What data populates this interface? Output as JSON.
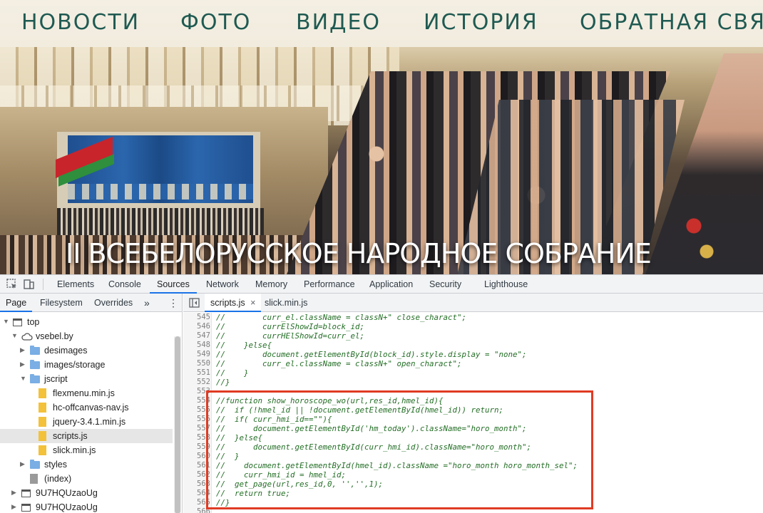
{
  "site": {
    "nav": [
      "НОВОСТИ",
      "ФОТО",
      "ВИДЕО",
      "ИСТОРИЯ",
      "ОБРАТНАЯ СВЯЗЬ"
    ],
    "banner_title": "II ВСЕБЕЛОРУССКОЕ НАРОДНОЕ СОБРАНИЕ"
  },
  "devtools": {
    "tabs": [
      "Elements",
      "Console",
      "Sources",
      "Network",
      "Memory",
      "Performance",
      "Application",
      "Security",
      "Lighthouse"
    ],
    "active_tab": "Sources",
    "navigator_tabs": [
      "Page",
      "Filesystem",
      "Overrides"
    ],
    "more_tabs": "»",
    "menu": "⋮",
    "tree": [
      {
        "label": "top",
        "type": "frame",
        "depth": 0,
        "expanded": true
      },
      {
        "label": "vsebel.by",
        "type": "domain",
        "depth": 1,
        "expanded": true
      },
      {
        "label": "desimages",
        "type": "folder",
        "depth": 2,
        "expanded": false
      },
      {
        "label": "images/storage",
        "type": "folder",
        "depth": 2,
        "expanded": false
      },
      {
        "label": "jscript",
        "type": "folder",
        "depth": 2,
        "expanded": true
      },
      {
        "label": "flexmenu.min.js",
        "type": "js",
        "depth": 3
      },
      {
        "label": "hc-offcanvas-nav.js",
        "type": "js",
        "depth": 3
      },
      {
        "label": "jquery-3.4.1.min.js",
        "type": "js",
        "depth": 3
      },
      {
        "label": "scripts.js",
        "type": "js",
        "depth": 3,
        "selected": true
      },
      {
        "label": "slick.min.js",
        "type": "js",
        "depth": 3
      },
      {
        "label": "styles",
        "type": "folder",
        "depth": 2,
        "expanded": false
      },
      {
        "label": "(index)",
        "type": "file",
        "depth": 2
      },
      {
        "label": "9U7HQUzaoUg",
        "type": "frame",
        "depth": 1,
        "expanded": false
      },
      {
        "label": "9U7HQUzaoUg",
        "type": "frame",
        "depth": 1,
        "expanded": false
      }
    ],
    "editor_tabs": [
      {
        "label": "scripts.js",
        "close": "×",
        "active": true
      },
      {
        "label": "slick.min.js",
        "active": false
      }
    ],
    "code": [
      {
        "n": "545",
        "t": "//        curr_el.className = classN+\" close_charact\";"
      },
      {
        "n": "546",
        "t": "//        currElShowId=block_id;"
      },
      {
        "n": "547",
        "t": "//        currHElShowId=curr_el;"
      },
      {
        "n": "548",
        "t": "//    }else{"
      },
      {
        "n": "549",
        "t": "//        document.getElementById(block_id).style.display = \"none\";"
      },
      {
        "n": "550",
        "t": "//        curr_el.className = classN+\" open_charact\";"
      },
      {
        "n": "551",
        "t": "//    }"
      },
      {
        "n": "552",
        "t": "//}"
      },
      {
        "n": "553",
        "t": ""
      },
      {
        "n": "554",
        "t": "//function show_horoscope_wo(url,res_id,hmel_id){"
      },
      {
        "n": "555",
        "t": "//  if (!hmel_id || !document.getElementById(hmel_id)) return;"
      },
      {
        "n": "556",
        "t": "//  if( curr_hmi_id==\"\"){"
      },
      {
        "n": "557",
        "t": "//      document.getElementById('hm_today').className=\"horo_month\";"
      },
      {
        "n": "558",
        "t": "//  }else{"
      },
      {
        "n": "559",
        "t": "//      document.getElementById(curr_hmi_id).className=\"horo_month\";"
      },
      {
        "n": "560",
        "t": "//  }"
      },
      {
        "n": "561",
        "t": "//    document.getElementById(hmel_id).className =\"horo_month horo_month_sel\";"
      },
      {
        "n": "562",
        "t": "//    curr_hmi_id = hmel_id;"
      },
      {
        "n": "563",
        "t": "//  get_page(url,res_id,0, '','',1);"
      },
      {
        "n": "564",
        "t": "//  return true;"
      },
      {
        "n": "565",
        "t": "//}"
      },
      {
        "n": "566",
        "t": ""
      }
    ],
    "highlight_color": "#e03b23"
  }
}
